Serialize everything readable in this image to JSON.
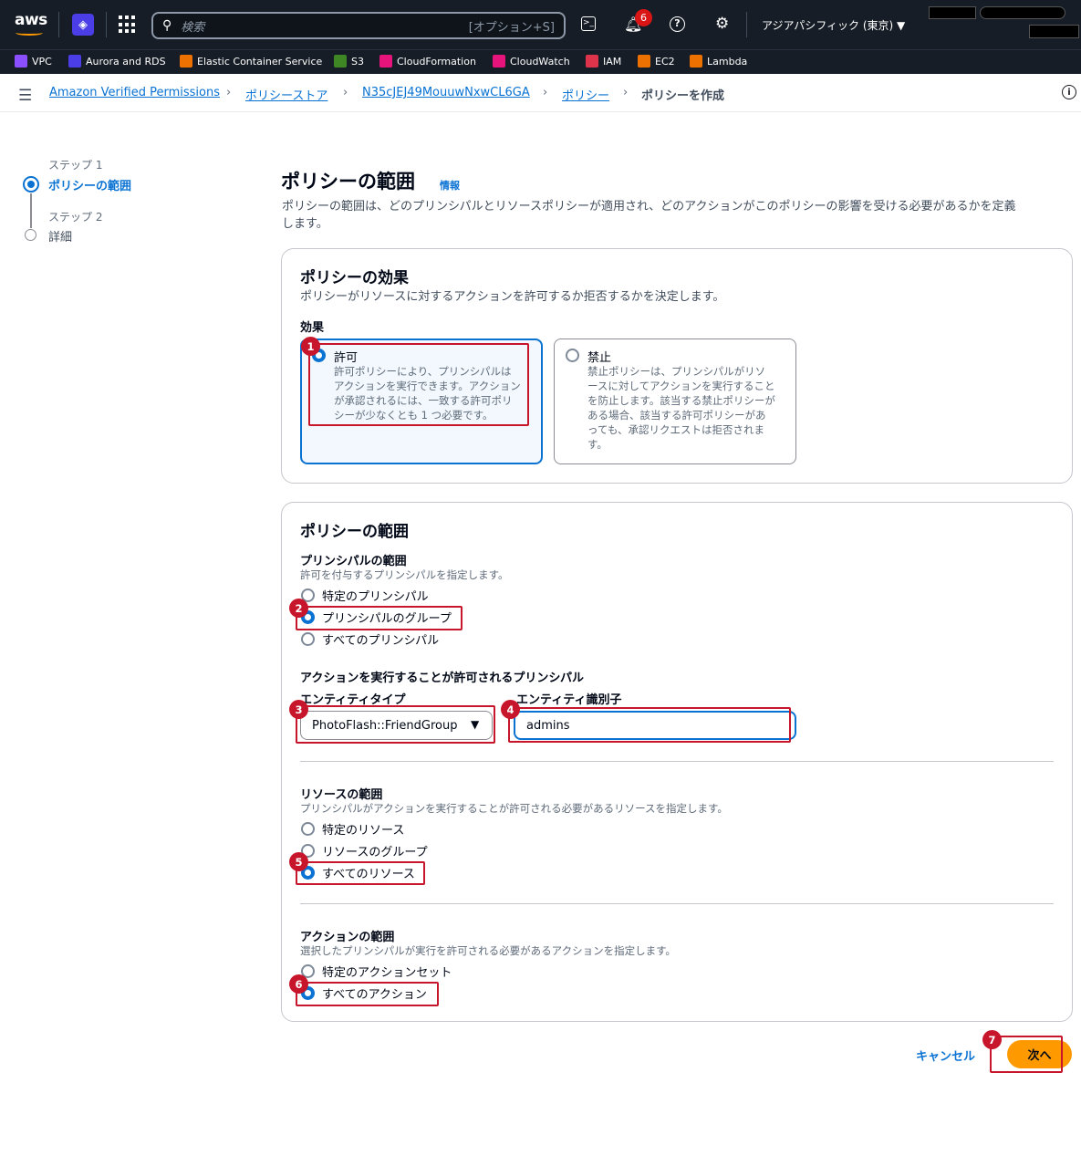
{
  "topnav": {
    "logo": "aws",
    "search_placeholder": "検索",
    "search_shortcut": "[オプション+S]",
    "notification_count": "6",
    "region": "アジアパシフィック (東京) ▼"
  },
  "favorites": [
    {
      "label": "VPC",
      "color": "#8c4fff"
    },
    {
      "label": "Aurora and RDS",
      "color": "#4b3ee6"
    },
    {
      "label": "Elastic Container Service",
      "color": "#ed7100"
    },
    {
      "label": "S3",
      "color": "#3f8624"
    },
    {
      "label": "CloudFormation",
      "color": "#e7157b"
    },
    {
      "label": "CloudWatch",
      "color": "#e7157b"
    },
    {
      "label": "IAM",
      "color": "#dd344c"
    },
    {
      "label": "EC2",
      "color": "#ed7100"
    },
    {
      "label": "Lambda",
      "color": "#ed7100"
    }
  ],
  "breadcrumb": {
    "items": [
      "Amazon Verified Permissions",
      "ポリシーストア",
      "N35cJEJ49MouuwNxwCL6GA",
      "ポリシー"
    ],
    "current": "ポリシーを作成"
  },
  "steps": [
    {
      "num": "ステップ 1",
      "label": "ポリシーの範囲"
    },
    {
      "num": "ステップ 2",
      "label": "詳細"
    }
  ],
  "page": {
    "title": "ポリシーの範囲",
    "info": "情報",
    "description_line1": "ポリシーの範囲は、どのプリンシパルとリソースポリシーが適用され、どのアクションがこのポリシーの影響を受ける必要があるかを定義",
    "description_line2": "します。"
  },
  "effect_panel": {
    "title": "ポリシーの効果",
    "description": "ポリシーがリソースに対するアクションを許可するか拒否するかを決定します。",
    "label": "効果",
    "permit": {
      "title": "許可",
      "lines": [
        "許可ポリシーにより、プリンシパルは",
        "アクションを実行できます。アクション",
        "が承認されるには、一致する許可ポリ",
        "シーが少なくとも 1 つ必要です。"
      ]
    },
    "forbid": {
      "title": "禁止",
      "lines": [
        "禁止ポリシーは、プリンシパルがリソ",
        "ースに対してアクションを実行すること",
        "を防止します。該当する禁止ポリシーが",
        "ある場合、該当する許可ポリシーがあ",
        "っても、承認リクエストは拒否されま",
        "す。"
      ]
    }
  },
  "scope_panel": {
    "title": "ポリシーの範囲",
    "principal_label": "プリンシパルの範囲",
    "principal_desc": "許可を付与するプリンシパルを指定します。",
    "principal_options": [
      "特定のプリンシパル",
      "プリンシパルのグループ",
      "すべてのプリンシパル"
    ],
    "allowed_principal_label": "アクションを実行することが許可されるプリンシパル",
    "entity_type_label": "エンティティタイプ",
    "entity_type_value": "PhotoFlash::FriendGroup",
    "entity_id_label": "エンティティ識別子",
    "entity_id_value": "admins",
    "resource_label": "リソースの範囲",
    "resource_desc": "プリンシパルがアクションを実行することが許可される必要があるリソースを指定します。",
    "resource_options": [
      "特定のリソース",
      "リソースのグループ",
      "すべてのリソース"
    ],
    "action_label": "アクションの範囲",
    "action_desc": "選択したプリンシパルが実行を許可される必要があるアクションを指定します。",
    "action_options": [
      "特定のアクションセット",
      "すべてのアクション"
    ]
  },
  "footer": {
    "cancel": "キャンセル",
    "next": "次へ"
  },
  "annotations": [
    "1",
    "2",
    "3",
    "4",
    "5",
    "6",
    "7"
  ]
}
